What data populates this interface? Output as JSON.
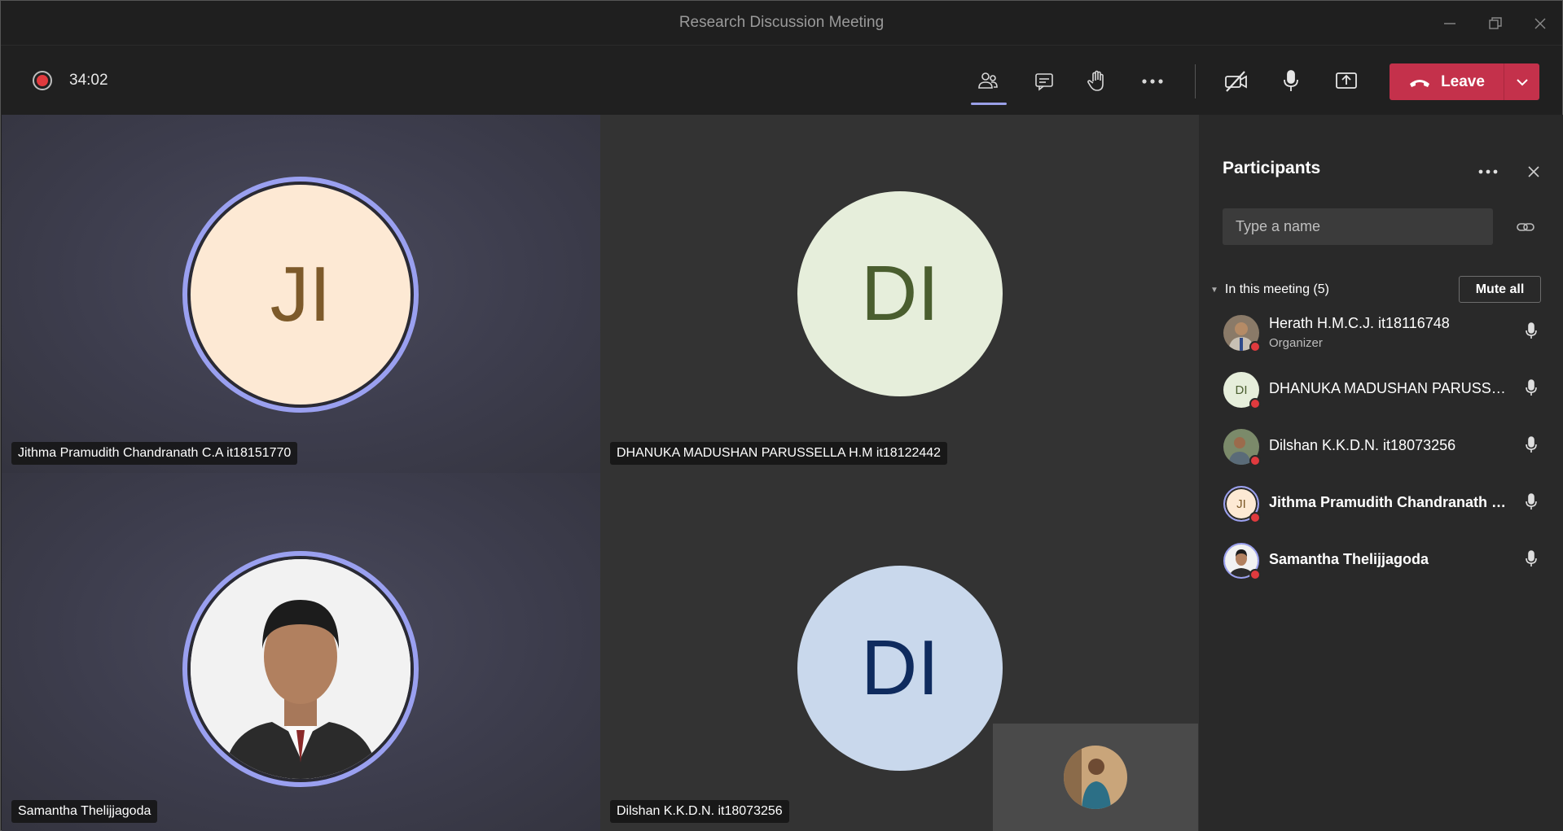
{
  "window": {
    "title": "Research Discussion Meeting"
  },
  "toolbar": {
    "timer": "34:02",
    "leave_label": "Leave"
  },
  "tiles": [
    {
      "name": "Jithma Pramudith Chandranath C.A it18151770",
      "initials": "JI",
      "bg": "#fde9d4",
      "fg": "#7d5a2a"
    },
    {
      "name": "DHANUKA MADUSHAN PARUSSELLA H.M it18122442",
      "initials": "DI",
      "bg": "#e6eedb",
      "fg": "#4a5e2f"
    },
    {
      "name": "Samantha Thelijjagoda"
    },
    {
      "name": "Dilshan K.K.D.N. it18073256",
      "initials": "DI",
      "bg": "#c9d8ec",
      "fg": "#0f2b5e"
    }
  ],
  "panel": {
    "title": "Participants",
    "search_placeholder": "Type a name",
    "section_label": "In this meeting (5)",
    "mute_all_label": "Mute all",
    "participants": [
      {
        "name": "Herath H.M.C.J. it18116748",
        "role": "Organizer"
      },
      {
        "name": "DHANUKA MADUSHAN PARUSSELLA H.M it18122442",
        "initials": "DI"
      },
      {
        "name": "Dilshan K.K.D.N. it18073256"
      },
      {
        "name": "Jithma Pramudith Chandranath C.A it18151770",
        "initials": "JI"
      },
      {
        "name": "Samantha Thelijjagoda"
      }
    ]
  },
  "colors": {
    "leave": "#c4314b",
    "ring": "#9aa0f0",
    "recording": "#e03a3e"
  }
}
